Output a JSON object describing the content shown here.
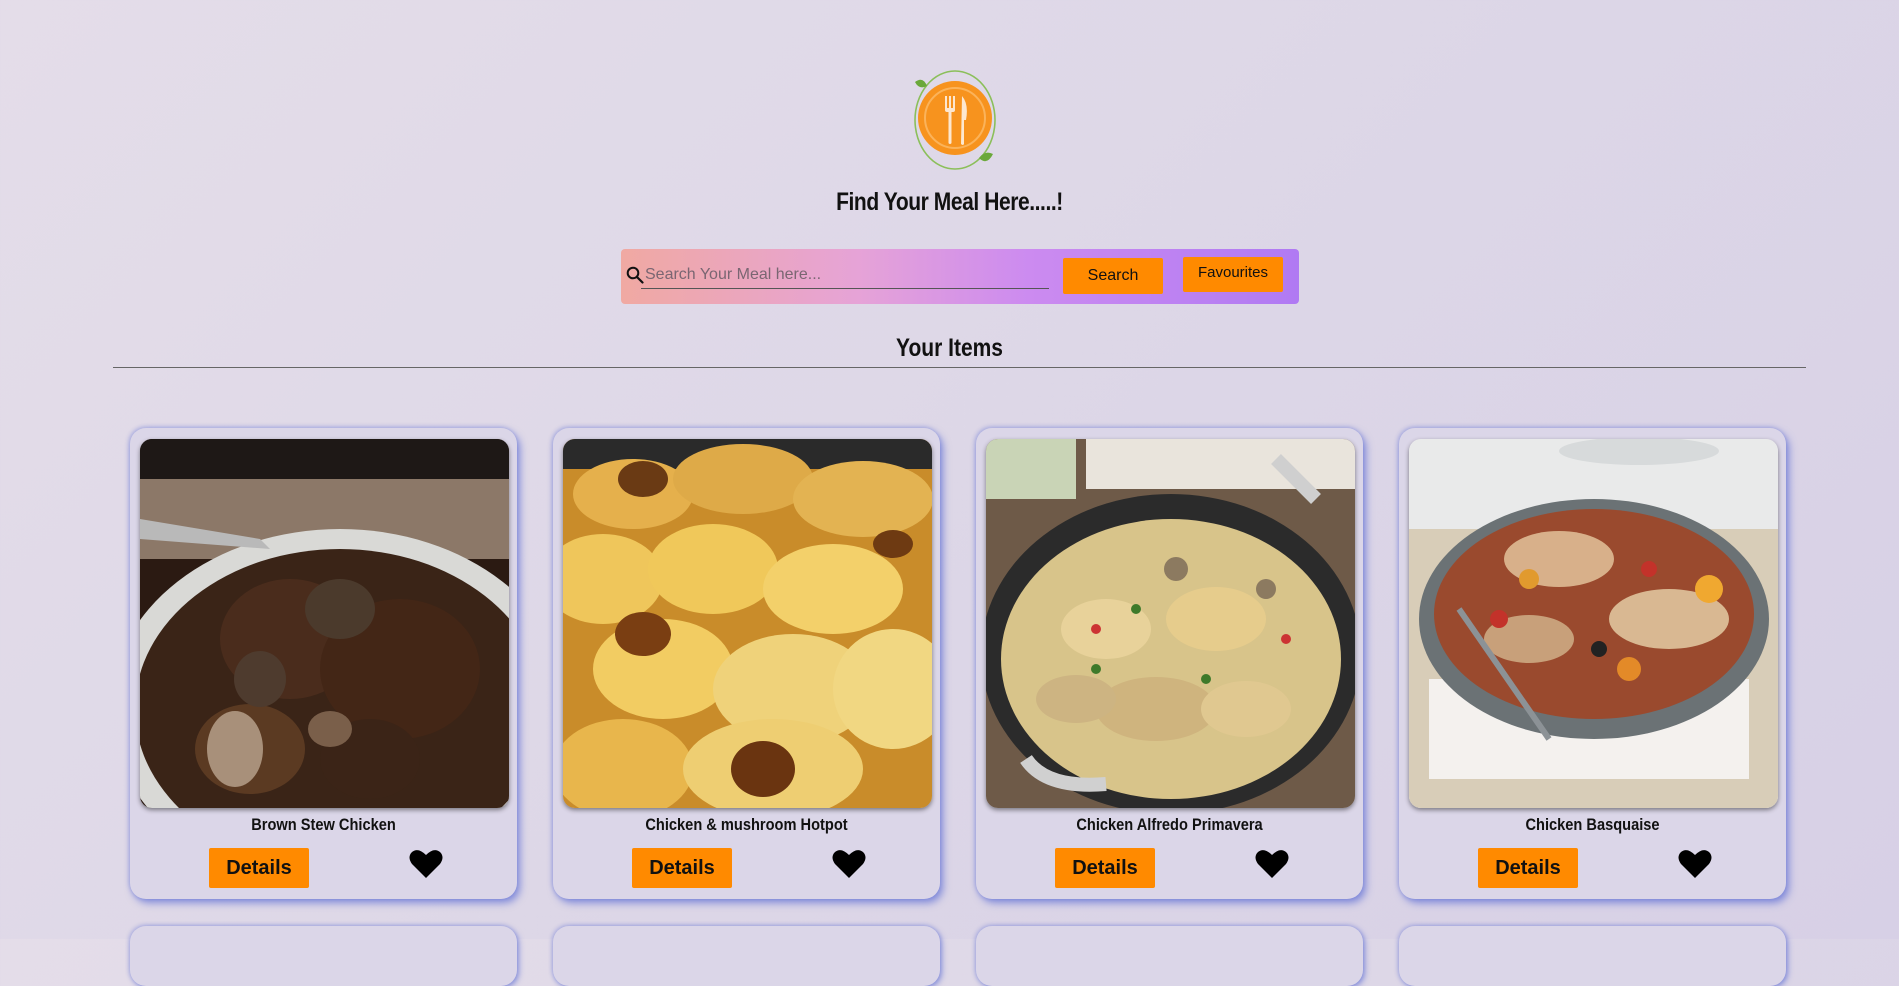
{
  "header": {
    "logo_icon": "fork-knife-plate-logo",
    "title": "Find Your Meal Here.....!"
  },
  "search": {
    "placeholder": "Search Your Meal here...",
    "value": "",
    "search_label": "Search",
    "favourites_label": "Favourites"
  },
  "section": {
    "title": "Your Items"
  },
  "cards": [
    {
      "name": "Brown Stew Chicken",
      "details_label": "Details",
      "favourite_icon": "heart-icon"
    },
    {
      "name": "Chicken & mushroom Hotpot",
      "details_label": "Details",
      "favourite_icon": "heart-icon"
    },
    {
      "name": "Chicken Alfredo Primavera",
      "details_label": "Details",
      "favourite_icon": "heart-icon"
    },
    {
      "name": "Chicken Basquaise",
      "details_label": "Details",
      "favourite_icon": "heart-icon"
    }
  ],
  "colors": {
    "accent": "#ff8a00",
    "card_glow": "#4a5ad2"
  }
}
